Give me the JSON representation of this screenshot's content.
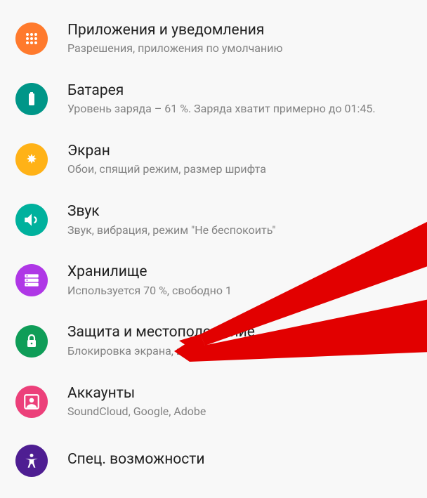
{
  "settings": {
    "items": [
      {
        "id": "apps",
        "title": "Приложения и уведомления",
        "subtitle": "Разрешения, приложения по умолчанию",
        "color": "#FF7A2D"
      },
      {
        "id": "battery",
        "title": "Батарея",
        "subtitle": "Уровень заряда – 61 %. Заряда хватит примерно до 01:45.",
        "color": "#009688"
      },
      {
        "id": "display",
        "title": "Экран",
        "subtitle": "Обои, спящий режим, размер шрифта",
        "color": "#FFB217"
      },
      {
        "id": "sound",
        "title": "Звук",
        "subtitle": "Звук, вибрация, режим \"Не беспокоить\"",
        "color": "#00B19D"
      },
      {
        "id": "storage",
        "title": "Хранилище",
        "subtitle": "Используется 70 %, свободно 1",
        "color": "#AF37E6"
      },
      {
        "id": "security",
        "title": "Защита и местоположение",
        "subtitle": "Блокировка экрана, цифровой отпечаток",
        "color": "#0F9D58"
      },
      {
        "id": "accounts",
        "title": "Аккаунты",
        "subtitle": "SoundCloud, Google, Adobe",
        "color": "#EC407A"
      },
      {
        "id": "accessibility",
        "title": "Спец. возможности",
        "subtitle": "",
        "color": "#4E1E92"
      }
    ]
  }
}
